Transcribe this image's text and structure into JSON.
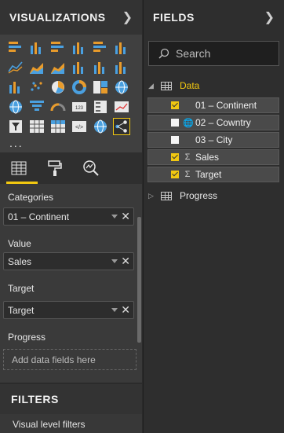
{
  "visualizations": {
    "title": "VISUALIZATIONS",
    "icons": [
      "stacked-bar-icon",
      "stacked-column-icon",
      "clustered-bar-icon",
      "clustered-column-icon",
      "100-bar-icon",
      "100-column-icon",
      "line-chart-icon",
      "area-chart-icon",
      "stacked-area-icon",
      "line-column-icon",
      "line-clustered-icon",
      "ribbon-chart-icon",
      "waterfall-icon",
      "scatter-icon",
      "pie-chart-icon",
      "donut-chart-icon",
      "treemap-icon",
      "map-icon",
      "filled-map-icon",
      "funnel-icon",
      "gauge-icon",
      "card-icon",
      "multirow-card-icon",
      "kpi-icon",
      "slicer-icon",
      "table-icon",
      "matrix-icon",
      "r-visual-icon",
      "globe-icon",
      "custom-network-icon"
    ],
    "more": "..."
  },
  "tabs": [
    "fields-tab",
    "format-tab",
    "analytics-tab"
  ],
  "wells": {
    "categories": {
      "label": "Categories",
      "value": "01 – Continent"
    },
    "value": {
      "label": "Value",
      "value": "Sales"
    },
    "target": {
      "label": "Target",
      "value": "Target"
    },
    "progress": {
      "label": "Progress",
      "placeholder": "Add data fields here"
    }
  },
  "filters": {
    "title": "FILTERS",
    "sub": "Visual level filters"
  },
  "fields": {
    "title": "FIELDS",
    "search_placeholder": "Search",
    "tables": [
      {
        "name": "Data",
        "expanded": true,
        "color": "#f2c811",
        "items": [
          {
            "label": "01 – Continent",
            "checked": true,
            "icon": ""
          },
          {
            "label": "02 – Cowntry",
            "checked": false,
            "icon": "globe"
          },
          {
            "label": "03 – City",
            "checked": false,
            "icon": ""
          },
          {
            "label": "Sales",
            "checked": true,
            "icon": "sigma"
          },
          {
            "label": "Target",
            "checked": true,
            "icon": "sigma"
          }
        ]
      },
      {
        "name": "Progress",
        "expanded": false
      }
    ]
  },
  "colors": {
    "accent": "#f2c811"
  }
}
